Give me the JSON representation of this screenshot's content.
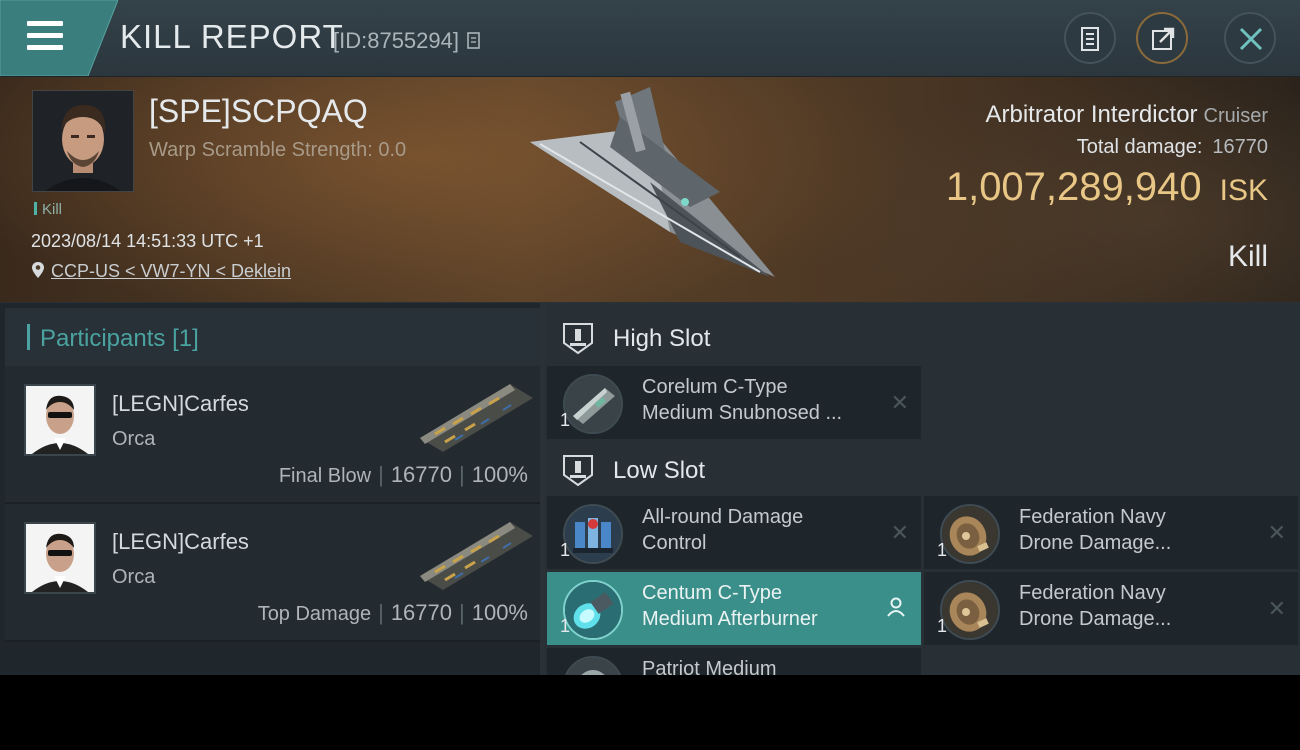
{
  "header": {
    "title": "KILL REPORT",
    "report_id": "[ID:8755294]",
    "icons": [
      "menu-icon",
      "copy-icon",
      "notes-icon",
      "share-icon",
      "close-icon"
    ]
  },
  "victim": {
    "pilot_name": "[SPE]SCPQAQ",
    "warp_scramble": "Warp Scramble Strength: 0.0",
    "badge": "Kill",
    "datetime": "2023/08/14 14:51:33 UTC +1",
    "location": "CCP-US < VW7-YN < Deklein",
    "ship_name": "Arbitrator Interdictor",
    "ship_class": "Cruiser",
    "total_damage_label": "Total damage:",
    "total_damage_value": "16770",
    "isk_value": "1,007,289,940",
    "isk_unit": "ISK",
    "result": "Kill"
  },
  "participants": {
    "title": "Participants",
    "count": "[1]",
    "rows": [
      {
        "name": "[LEGN]Carfes",
        "ship": "Orca",
        "role": "Final Blow",
        "damage": "16770",
        "percent": "100%"
      },
      {
        "name": "[LEGN]Carfes",
        "ship": "Orca",
        "role": "Top Damage",
        "damage": "16770",
        "percent": "100%"
      }
    ]
  },
  "fittings": {
    "high_slot": {
      "title": "High Slot",
      "modules": [
        {
          "qty": "1",
          "line1": "Corelum C-Type",
          "line2": "Medium Snubnosed ...",
          "action": "✕"
        }
      ]
    },
    "low_slot": {
      "title": "Low Slot",
      "modules": [
        {
          "qty": "1",
          "line1": "All-round Damage",
          "line2": "Control",
          "action": "✕"
        },
        {
          "qty": "1",
          "line1": "Federation Navy",
          "line2": "Drone Damage...",
          "action": "✕"
        },
        {
          "qty": "1",
          "line1": "Centum C-Type",
          "line2": "Medium Afterburner",
          "action": "person-icon"
        },
        {
          "qty": "1",
          "line1": "Federation Navy",
          "line2": "Drone Damage...",
          "action": "✕"
        },
        {
          "qty": "",
          "line1": "Patriot Medium",
          "line2": "",
          "action": ""
        }
      ]
    }
  }
}
